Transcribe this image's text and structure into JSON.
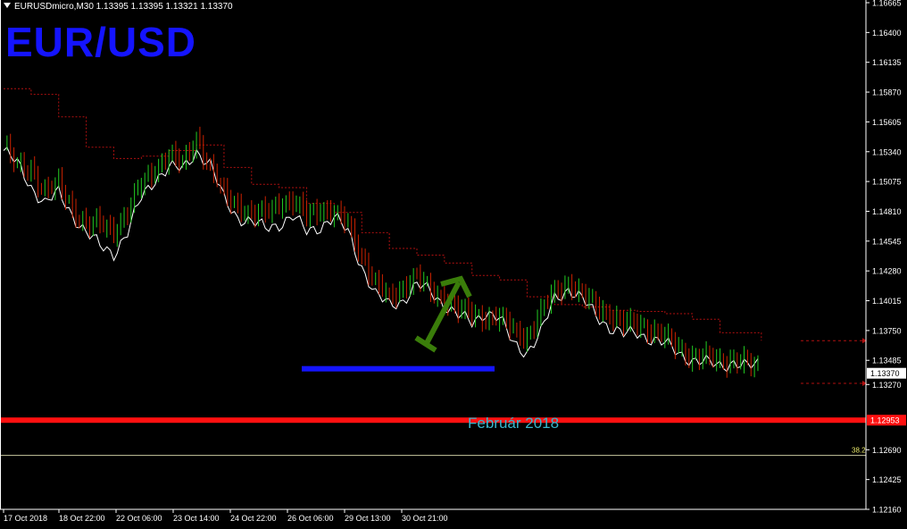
{
  "header": {
    "symbol_line": "EURUSDmicro,M30  1.13395 1.13395 1.13321 1.13370"
  },
  "overlay": {
    "pair_title": "EUR/USD",
    "zone_label": "Február 2018",
    "fib_label": "38.2"
  },
  "colors": {
    "background": "#000000",
    "axis": "#ffffff",
    "bull_candle": "#22cc22",
    "bear_candle": "#cc2200",
    "close_line": "#ffffff",
    "resistance_dotted": "#b01010",
    "support_line": "#1414ff",
    "key_level": "#ff1010",
    "arrow": "#3a7d0a",
    "fib_line": "#c8c8a0",
    "zone_text": "#36b6cc"
  },
  "chart_data": {
    "type": "candlestick",
    "ylim": [
      1.1216,
      1.16665
    ],
    "y_ticks": [
      "1.16665",
      "1.16400",
      "1.16135",
      "1.15870",
      "1.15605",
      "1.15340",
      "1.15075",
      "1.14810",
      "1.14545",
      "1.14280",
      "1.14015",
      "1.13750",
      "1.13485",
      "1.13270",
      "1.12690",
      "1.12425",
      "1.12160"
    ],
    "x_ticks": [
      "17 Oct 2018",
      "18 Oct 22:00",
      "22 Oct 06:00",
      "23 Oct 14:00",
      "24 Oct 22:00",
      "26 Oct 06:00",
      "29 Oct 13:00",
      "30 Oct 21:00"
    ],
    "current_price": "1.13370",
    "key_level_price": "1.12953",
    "support_level": 1.1341,
    "fib_38_level": 1.1264,
    "upper_right_marker": 1.1366,
    "lower_right_marker": 1.1328,
    "close_path": [
      [
        0,
        1.1535
      ],
      [
        1,
        1.1523
      ],
      [
        2,
        1.1503
      ],
      [
        3,
        1.1488
      ],
      [
        4,
        1.1497
      ],
      [
        5,
        1.1478
      ],
      [
        6,
        1.1462
      ],
      [
        7,
        1.145
      ],
      [
        8,
        1.1444
      ],
      [
        9,
        1.1462
      ],
      [
        10,
        1.1493
      ],
      [
        11,
        1.151
      ],
      [
        12,
        1.152
      ],
      [
        13,
        1.1518
      ],
      [
        14,
        1.1535
      ],
      [
        15,
        1.1522
      ],
      [
        16,
        1.1492
      ],
      [
        17,
        1.1476
      ],
      [
        18,
        1.1471
      ],
      [
        19,
        1.1466
      ],
      [
        20,
        1.147
      ],
      [
        21,
        1.1476
      ],
      [
        22,
        1.1463
      ],
      [
        23,
        1.1468
      ],
      [
        24,
        1.1475
      ],
      [
        25,
        1.1463
      ],
      [
        26,
        1.1432
      ],
      [
        27,
        1.1406
      ],
      [
        28,
        1.1398
      ],
      [
        29,
        1.1402
      ],
      [
        30,
        1.1415
      ],
      [
        31,
        1.141
      ],
      [
        32,
        1.1398
      ],
      [
        33,
        1.1388
      ],
      [
        34,
        1.1382
      ],
      [
        35,
        1.1392
      ],
      [
        36,
        1.1385
      ],
      [
        37,
        1.1364
      ],
      [
        38,
        1.1356
      ],
      [
        39,
        1.1372
      ],
      [
        40,
        1.1404
      ],
      [
        41,
        1.1412
      ],
      [
        42,
        1.1402
      ],
      [
        43,
        1.1389
      ],
      [
        44,
        1.1378
      ],
      [
        45,
        1.1371
      ],
      [
        46,
        1.1373
      ],
      [
        47,
        1.1368
      ],
      [
        48,
        1.1363
      ],
      [
        49,
        1.1355
      ],
      [
        50,
        1.1349
      ],
      [
        51,
        1.1346
      ],
      [
        52,
        1.1344
      ],
      [
        53,
        1.1347
      ],
      [
        54,
        1.1342
      ],
      [
        55,
        1.1346
      ]
    ],
    "candle_path": [
      [
        0,
        1.154
      ],
      [
        1,
        1.152
      ],
      [
        2,
        1.152
      ],
      [
        3,
        1.1498
      ],
      [
        4,
        1.1505
      ],
      [
        5,
        1.1484
      ],
      [
        6,
        1.1468
      ],
      [
        7,
        1.147
      ],
      [
        8,
        1.1465
      ],
      [
        9,
        1.148
      ],
      [
        10,
        1.1505
      ],
      [
        11,
        1.152
      ],
      [
        12,
        1.153
      ],
      [
        13,
        1.1523
      ],
      [
        14,
        1.1548
      ],
      [
        15,
        1.1518
      ],
      [
        16,
        1.1496
      ],
      [
        17,
        1.1488
      ],
      [
        18,
        1.1476
      ],
      [
        19,
        1.148
      ],
      [
        20,
        1.149
      ],
      [
        21,
        1.1488
      ],
      [
        22,
        1.1478
      ],
      [
        23,
        1.1485
      ],
      [
        24,
        1.1478
      ],
      [
        25,
        1.147
      ],
      [
        26,
        1.1442
      ],
      [
        27,
        1.1416
      ],
      [
        28,
        1.1404
      ],
      [
        29,
        1.1415
      ],
      [
        30,
        1.1422
      ],
      [
        31,
        1.141
      ],
      [
        32,
        1.1405
      ],
      [
        33,
        1.1392
      ],
      [
        34,
        1.139
      ],
      [
        35,
        1.1388
      ],
      [
        36,
        1.1385
      ],
      [
        37,
        1.1376
      ],
      [
        38,
        1.137
      ],
      [
        39,
        1.139
      ],
      [
        40,
        1.141
      ],
      [
        41,
        1.1418
      ],
      [
        42,
        1.1405
      ],
      [
        43,
        1.1398
      ],
      [
        44,
        1.139
      ],
      [
        45,
        1.138
      ],
      [
        46,
        1.1382
      ],
      [
        47,
        1.1376
      ],
      [
        48,
        1.1368
      ],
      [
        49,
        1.136
      ],
      [
        50,
        1.1352
      ],
      [
        51,
        1.135
      ],
      [
        52,
        1.1348
      ],
      [
        53,
        1.135
      ],
      [
        54,
        1.1345
      ],
      [
        55,
        1.1338
      ]
    ],
    "resistance_path": [
      [
        0,
        1.159
      ],
      [
        2,
        1.1585
      ],
      [
        4,
        1.1565
      ],
      [
        6,
        1.1538
      ],
      [
        8,
        1.1528
      ],
      [
        10,
        1.153
      ],
      [
        12,
        1.1535
      ],
      [
        14,
        1.154
      ],
      [
        16,
        1.152
      ],
      [
        18,
        1.1505
      ],
      [
        20,
        1.1502
      ],
      [
        22,
        1.1488
      ],
      [
        24,
        1.148
      ],
      [
        26,
        1.1462
      ],
      [
        28,
        1.1448
      ],
      [
        30,
        1.1442
      ],
      [
        32,
        1.1435
      ],
      [
        34,
        1.1424
      ],
      [
        36,
        1.142
      ],
      [
        38,
        1.1405
      ],
      [
        40,
        1.1398
      ],
      [
        42,
        1.1396
      ],
      [
        44,
        1.1393
      ],
      [
        46,
        1.1392
      ],
      [
        48,
        1.139
      ],
      [
        50,
        1.1385
      ],
      [
        52,
        1.1373
      ],
      [
        55,
        1.1366
      ]
    ],
    "forecast_arrow": {
      "from": [
        53,
        1.1368
      ],
      "to": [
        57,
        1.1425
      ]
    }
  }
}
